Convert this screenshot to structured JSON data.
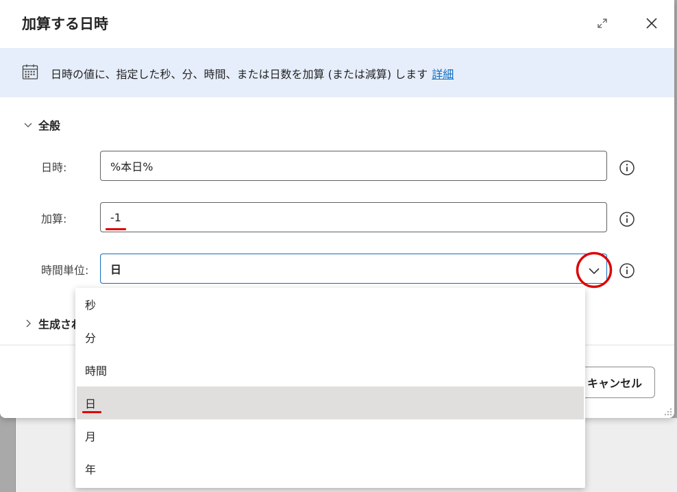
{
  "dialog": {
    "title": "加算する日時",
    "banner": {
      "text": "日時の値に、指定した秒、分、時間、または日数を加算 (または減算) します",
      "link": "詳細"
    },
    "general_section": "全般",
    "generated_section": "生成され",
    "fields": {
      "datetime": {
        "label": "日時:",
        "value": "%本日%"
      },
      "add": {
        "label": "加算:",
        "value": "-1"
      },
      "unit": {
        "label": "時間単位:",
        "value": "日"
      }
    },
    "cancel_label": "キャンセル"
  },
  "dropdown": {
    "options": [
      "秒",
      "分",
      "時間",
      "日",
      "月",
      "年"
    ],
    "selected_index": 3
  },
  "colors": {
    "accent": "#0f6cbd",
    "annotation": "#dd0000",
    "banner_bg": "#e6eefb"
  }
}
